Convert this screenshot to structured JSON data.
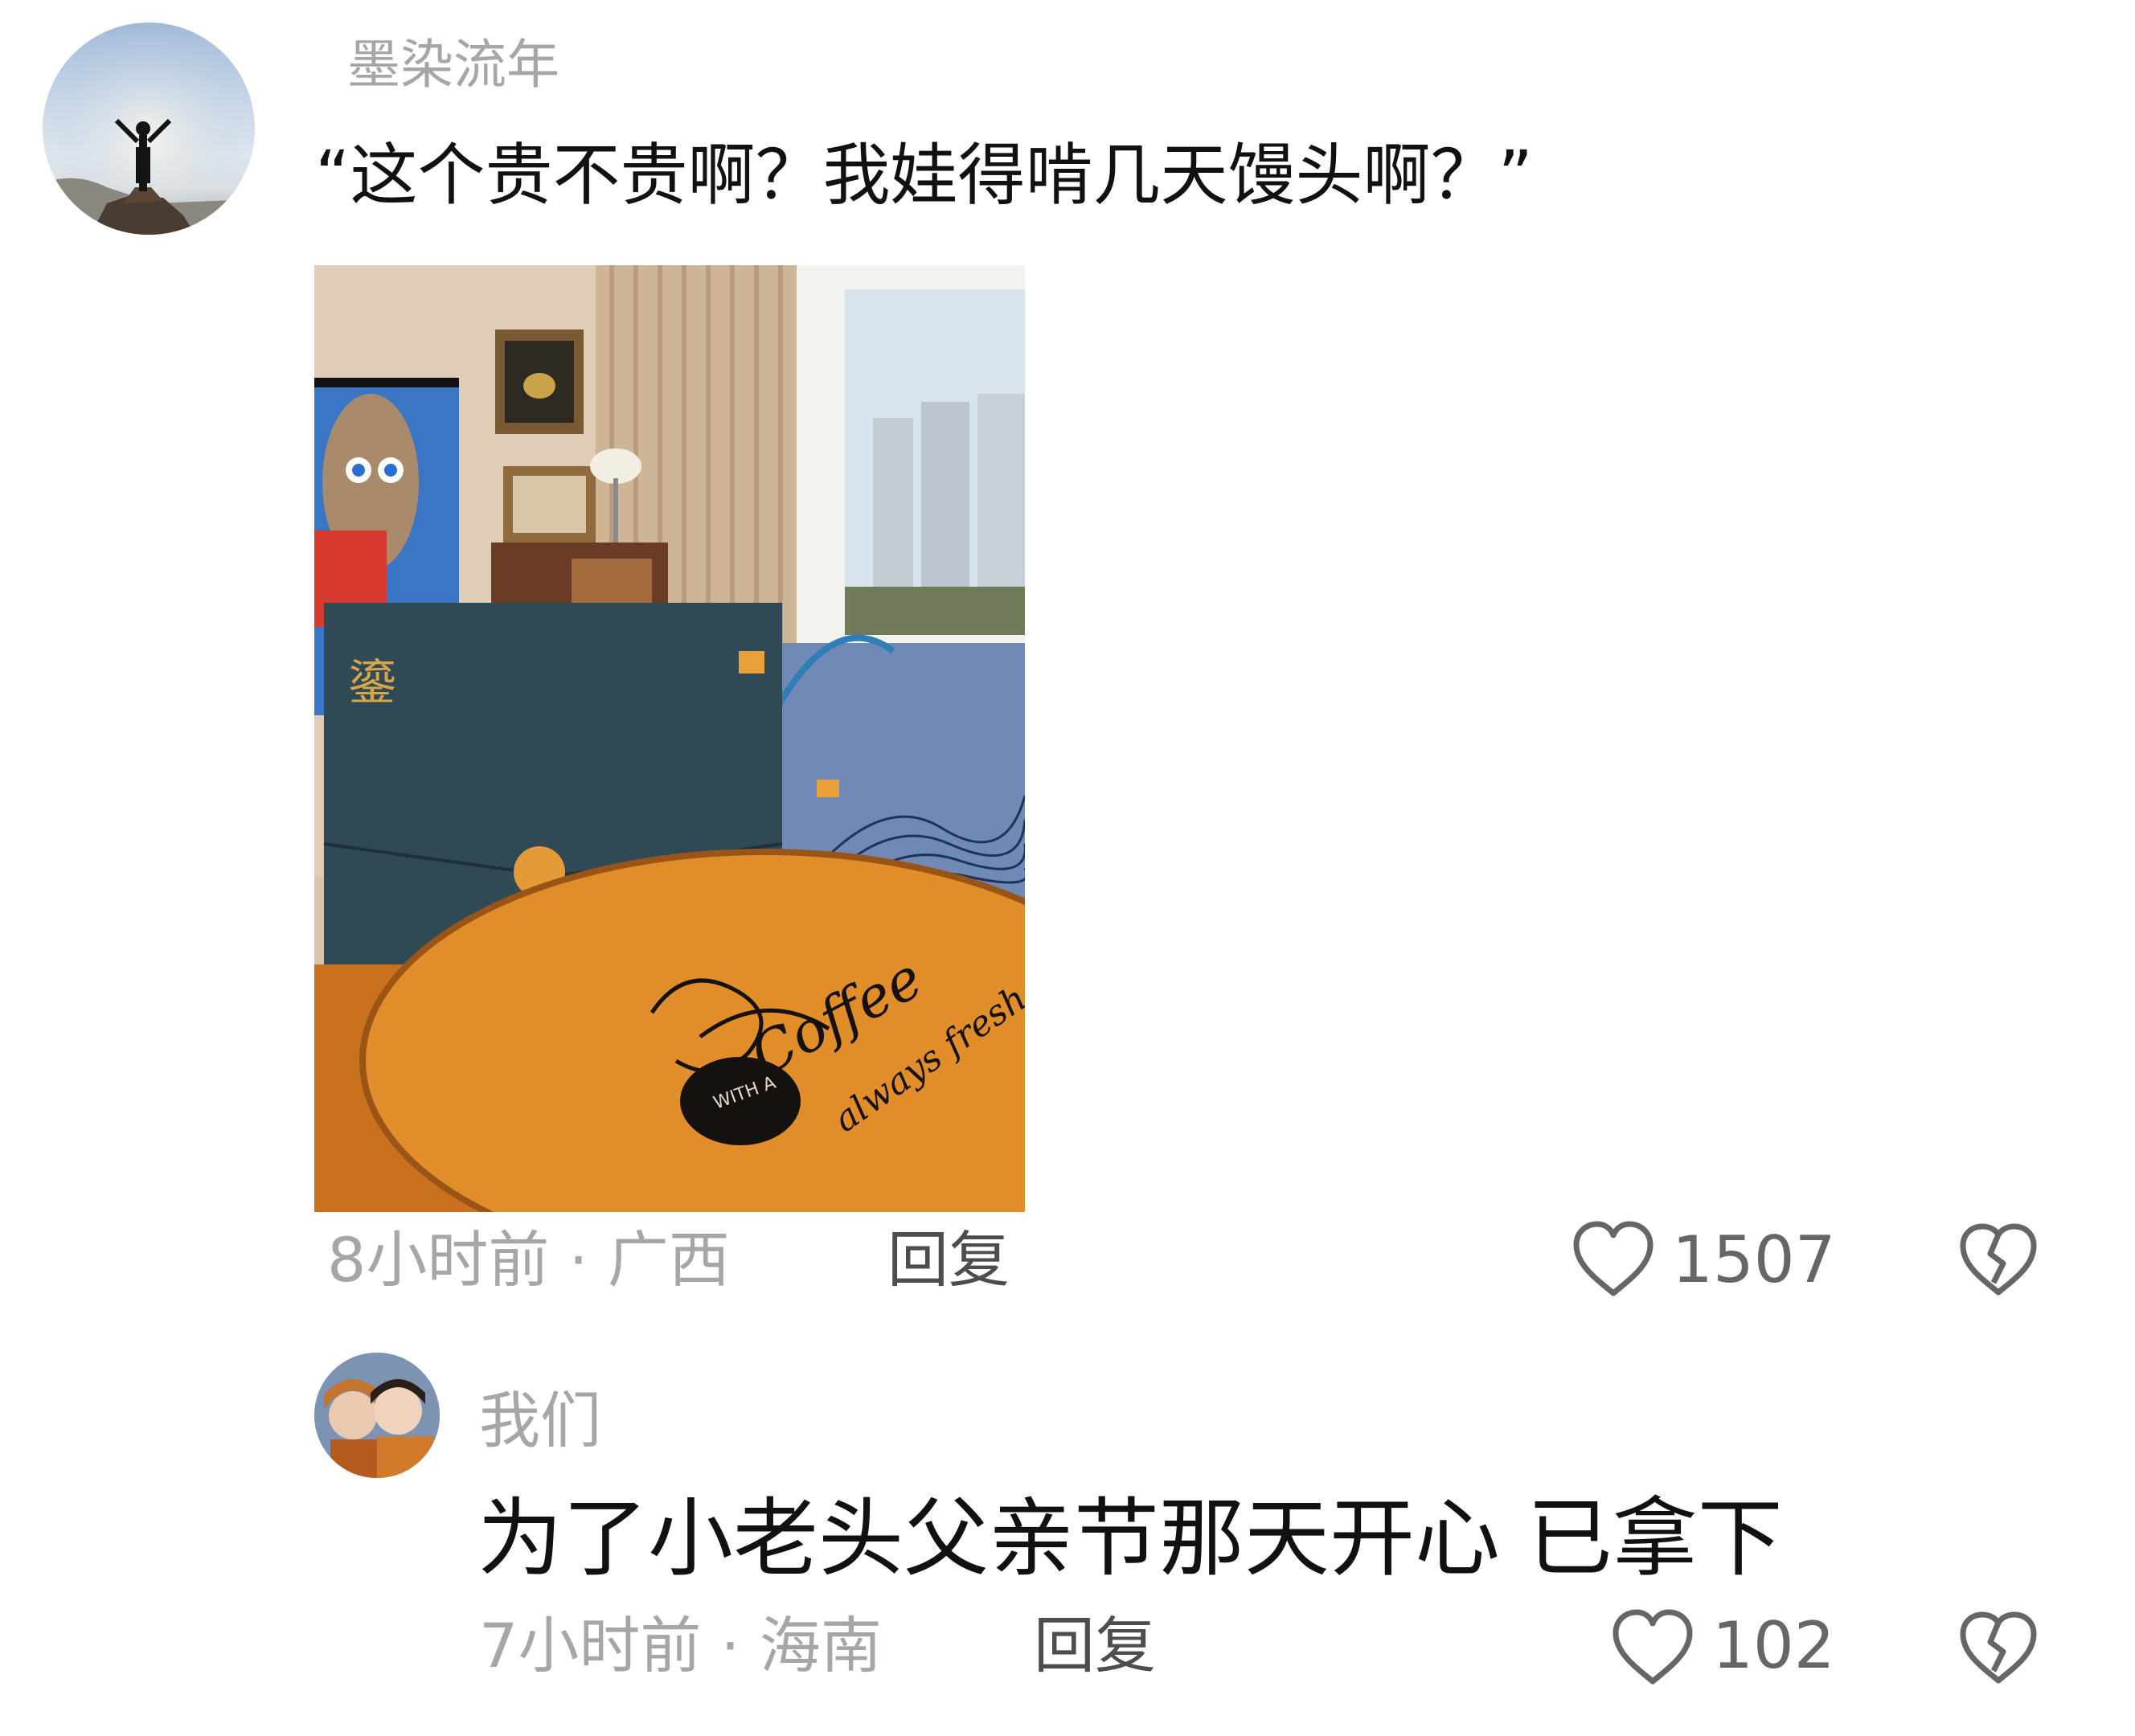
{
  "comments": [
    {
      "username": "墨染流年",
      "text": "“这个贵不贵啊？我娃得啃几天馒头啊？”",
      "time_location": "8小时前 · 广西",
      "reply_label": "回复",
      "like_count": "1507",
      "image": {
        "description_icons": [
          "gift-box",
          "gift-bag",
          "wooden-table"
        ],
        "table_text": [
          "Coffee",
          "always fresh",
          "WITH A"
        ]
      }
    },
    {
      "username": "我们",
      "text": "为了小老头父亲节那天开心 已拿下",
      "time_location": "7小时前 · 海南",
      "reply_label": "回复",
      "like_count": "102"
    }
  ],
  "colors": {
    "username": "#a6a6a6",
    "text": "#111111",
    "meta": "#a6a6a6",
    "reply": "#4d4d4d",
    "icon": "#666666"
  }
}
